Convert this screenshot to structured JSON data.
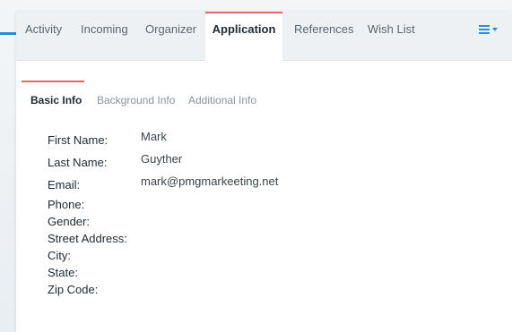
{
  "tabs": [
    {
      "label": "Activity"
    },
    {
      "label": "Incoming"
    },
    {
      "label": "Organizer"
    },
    {
      "label": "Application",
      "active": true
    },
    {
      "label": "References"
    },
    {
      "label": "Wish List"
    }
  ],
  "menu_icon": "hamburger-menu-icon",
  "accent_color": "#e0686a",
  "link_color": "#2c8fc7",
  "subtabs": [
    {
      "label": "Basic Info",
      "active": true
    },
    {
      "label": "Background Info"
    },
    {
      "label": "Additional Info"
    }
  ],
  "fields": [
    {
      "label": "First Name:",
      "value": "Mark"
    },
    {
      "label": "Last Name:",
      "value": "Guyther"
    },
    {
      "label": "Email:",
      "value": "mark@pmgmarkeeting.net"
    },
    {
      "label": "Phone:",
      "value": ""
    },
    {
      "label": "Gender:",
      "value": ""
    },
    {
      "label": "Street Address:",
      "value": ""
    },
    {
      "label": "City:",
      "value": ""
    },
    {
      "label": "State:",
      "value": ""
    },
    {
      "label": "Zip Code:",
      "value": ""
    }
  ]
}
